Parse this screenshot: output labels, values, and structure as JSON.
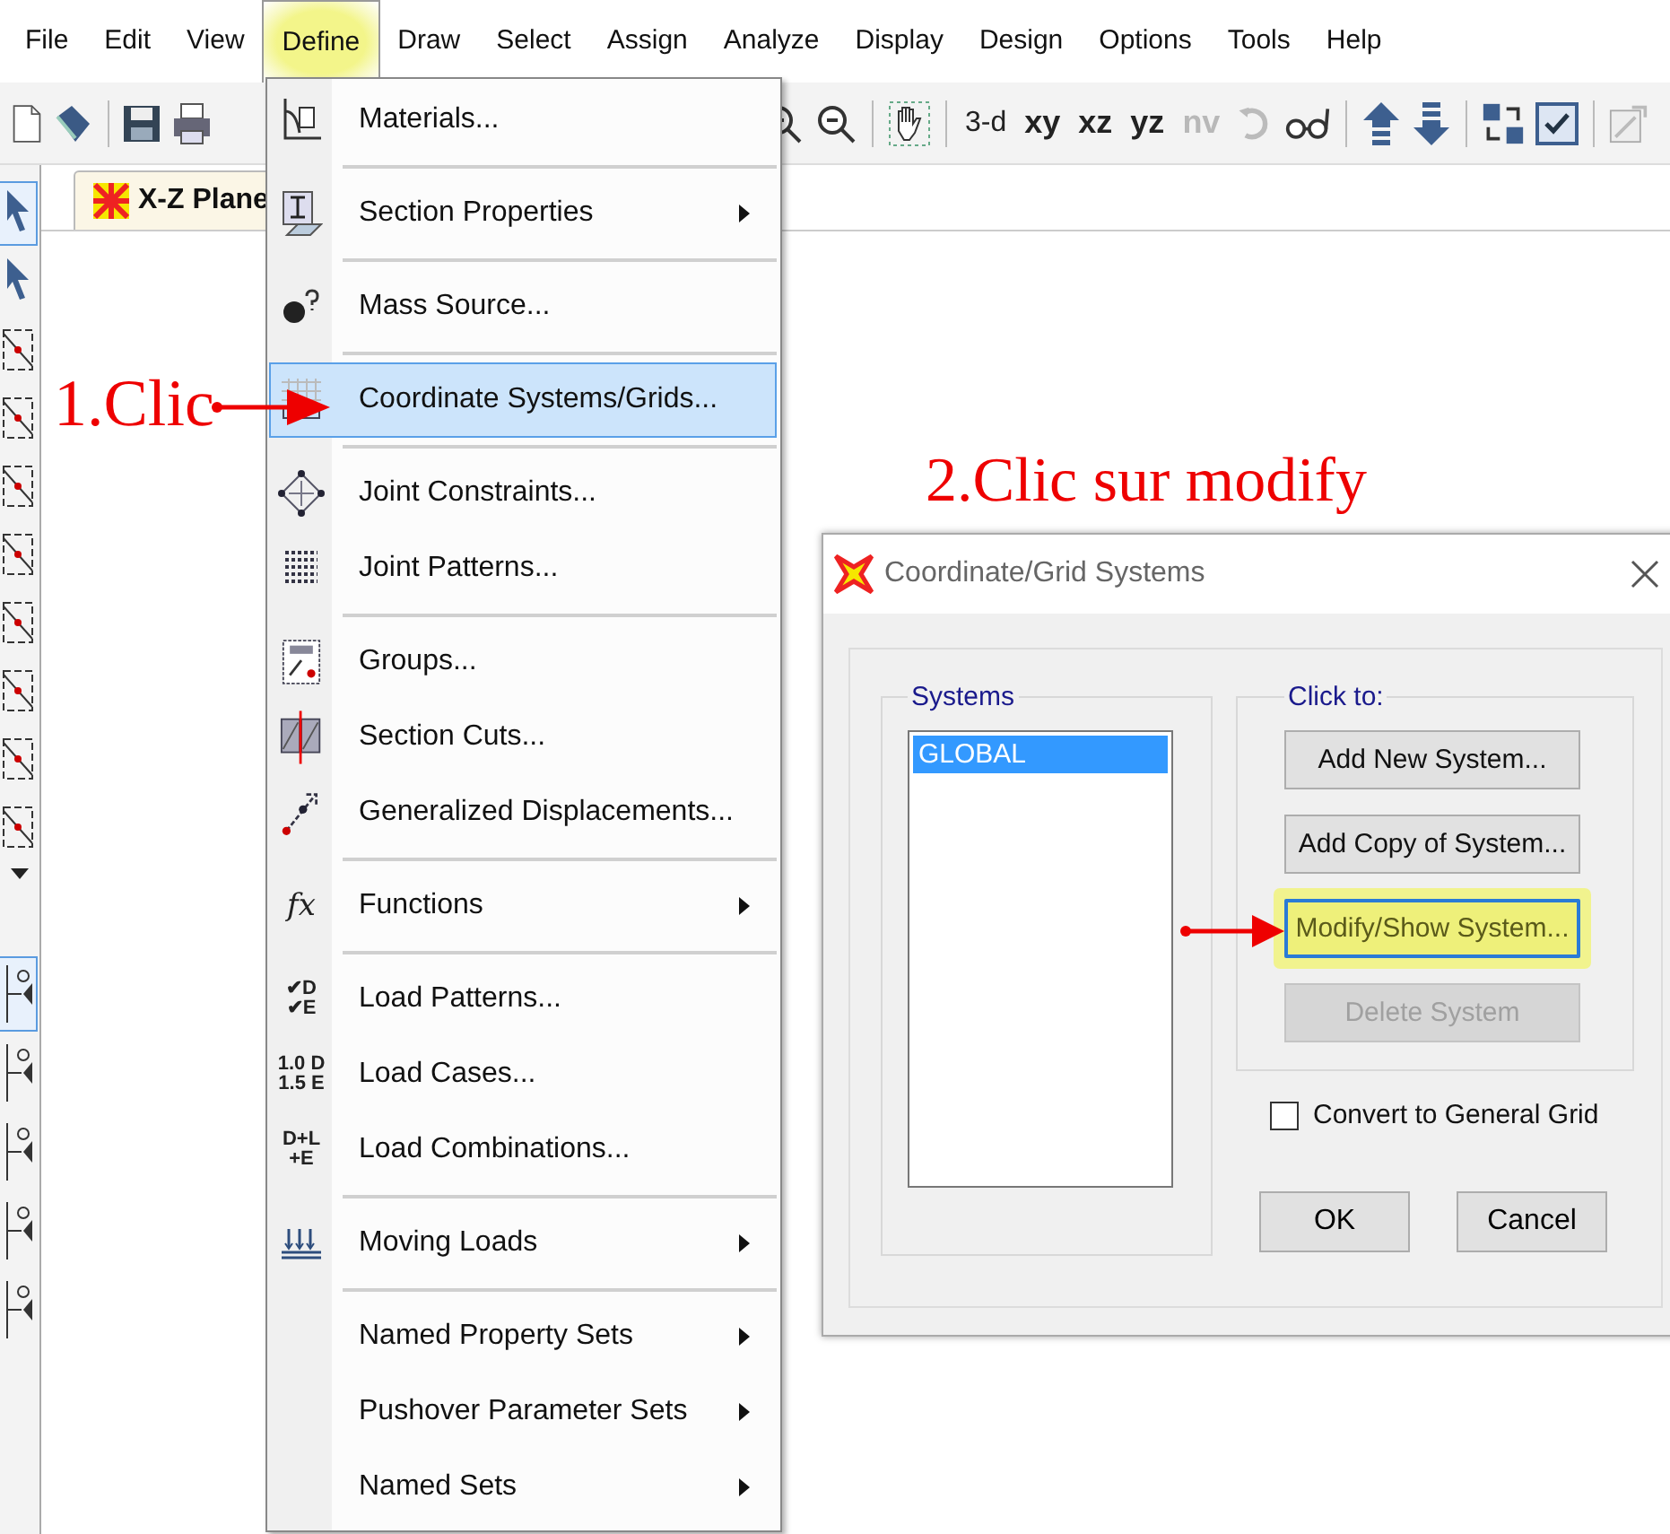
{
  "menu_bar": [
    {
      "label": "File",
      "selected": false
    },
    {
      "label": "Edit",
      "selected": false
    },
    {
      "label": "View",
      "selected": false
    },
    {
      "label": "Define",
      "selected": true
    },
    {
      "label": "Draw",
      "selected": false
    },
    {
      "label": "Select",
      "selected": false
    },
    {
      "label": "Assign",
      "selected": false
    },
    {
      "label": "Analyze",
      "selected": false
    },
    {
      "label": "Display",
      "selected": false
    },
    {
      "label": "Design",
      "selected": false
    },
    {
      "label": "Options",
      "selected": false
    },
    {
      "label": "Tools",
      "selected": false
    },
    {
      "label": "Help",
      "selected": false
    }
  ],
  "toolbar": {
    "view_buttons": [
      {
        "label": "3-d",
        "kind": "light",
        "disabled": false
      },
      {
        "label": "xy",
        "kind": "bold",
        "disabled": false
      },
      {
        "label": "xz",
        "kind": "bold",
        "disabled": false
      },
      {
        "label": "yz",
        "kind": "bold",
        "disabled": false
      },
      {
        "label": "nv",
        "kind": "bold",
        "disabled": true
      }
    ]
  },
  "tab": {
    "title": "X-Z Plane"
  },
  "define_menu": {
    "groups": [
      [
        {
          "label": "Materials...",
          "submenu": false,
          "highlighted": false
        }
      ],
      [
        {
          "label": "Section Properties",
          "submenu": true,
          "highlighted": false
        }
      ],
      [
        {
          "label": "Mass Source...",
          "submenu": false,
          "highlighted": false
        }
      ],
      [
        {
          "label": "Coordinate Systems/Grids...",
          "submenu": false,
          "highlighted": true
        }
      ],
      [
        {
          "label": "Joint Constraints...",
          "submenu": false,
          "highlighted": false
        },
        {
          "label": "Joint Patterns...",
          "submenu": false,
          "highlighted": false
        }
      ],
      [
        {
          "label": "Groups...",
          "submenu": false,
          "highlighted": false
        },
        {
          "label": "Section Cuts...",
          "submenu": false,
          "highlighted": false
        },
        {
          "label": "Generalized Displacements...",
          "submenu": false,
          "highlighted": false
        }
      ],
      [
        {
          "label": "Functions",
          "submenu": true,
          "highlighted": false,
          "icon_text": {
            "kind": "formula",
            "lines": [
              "fx"
            ]
          }
        }
      ],
      [
        {
          "label": "Load Patterns...",
          "submenu": false,
          "highlighted": false,
          "icon_text": {
            "kind": "plain",
            "lines": [
              "✔D",
              "✔E"
            ]
          }
        },
        {
          "label": "Load Cases...",
          "submenu": false,
          "highlighted": false,
          "icon_text": {
            "kind": "plain",
            "lines": [
              "1.0 D",
              "1.5 E"
            ]
          }
        },
        {
          "label": "Load Combinations...",
          "submenu": false,
          "highlighted": false,
          "icon_text": {
            "kind": "plain",
            "lines": [
              "D+L",
              "+E"
            ]
          }
        }
      ],
      [
        {
          "label": "Moving Loads",
          "submenu": true,
          "highlighted": false
        }
      ],
      [
        {
          "label": "Named Property Sets",
          "submenu": true,
          "highlighted": false
        },
        {
          "label": "Pushover Parameter Sets",
          "submenu": true,
          "highlighted": false
        },
        {
          "label": "Named Sets",
          "submenu": true,
          "highlighted": false
        }
      ]
    ]
  },
  "annotations": [
    {
      "text": "1.Clic"
    },
    {
      "text": "2.Clic sur modify"
    }
  ],
  "dialog": {
    "title": "Coordinate/Grid Systems",
    "systems_label": "Systems",
    "systems": [
      {
        "label": "GLOBAL",
        "selected": true
      }
    ],
    "click_to_label": "Click to:",
    "actions": [
      {
        "label": "Add New System...",
        "disabled": false,
        "focused": false
      },
      {
        "label": "Add Copy of System...",
        "disabled": false,
        "focused": false
      },
      {
        "label": "Modify/Show System...",
        "disabled": false,
        "focused": true
      },
      {
        "label": "Delete System",
        "disabled": true,
        "focused": false
      }
    ],
    "convert_checkbox": {
      "label": "Convert to General Grid",
      "checked": false
    },
    "buttons": [
      "OK",
      "Cancel"
    ]
  }
}
